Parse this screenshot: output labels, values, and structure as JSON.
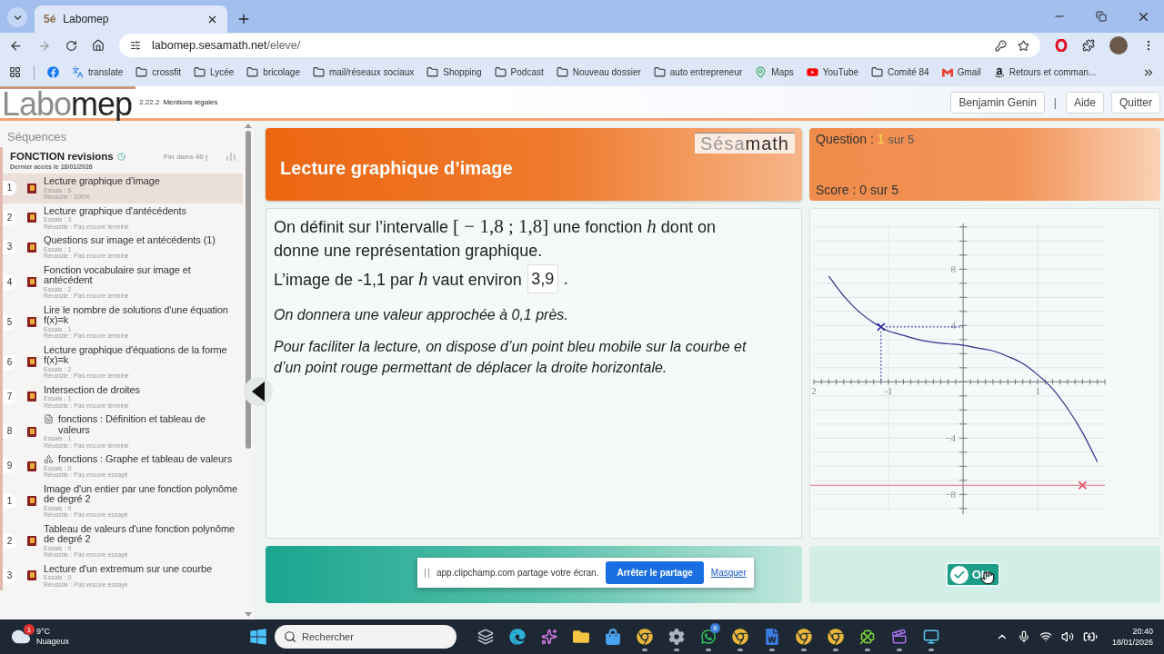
{
  "browser": {
    "tabs": [
      {
        "favicon": "5é",
        "title": "Labomep",
        "selected": true
      }
    ],
    "url": {
      "host": "labomep.sesamath.net",
      "path": "/eleve/"
    },
    "bookmarks": [
      {
        "kind": "facebook"
      },
      {
        "kind": "translate",
        "label": "translate"
      },
      {
        "kind": "folder",
        "label": "crossfit"
      },
      {
        "kind": "folder",
        "label": "Lycée"
      },
      {
        "kind": "folder",
        "label": "bricolage"
      },
      {
        "kind": "folder",
        "label": "mail/réseaux sociaux"
      },
      {
        "kind": "folder",
        "label": "Shopping"
      },
      {
        "kind": "folder",
        "label": "Podcast"
      },
      {
        "kind": "folder",
        "label": "Nouveau dossier"
      },
      {
        "kind": "folder",
        "label": "auto entrepreneur"
      },
      {
        "kind": "maps",
        "label": "Maps"
      },
      {
        "kind": "youtube",
        "label": "YouTube"
      },
      {
        "kind": "folder",
        "label": "Comité 84"
      },
      {
        "kind": "gmail",
        "label": "Gmail"
      },
      {
        "kind": "amazon",
        "label": "Retours et comman..."
      }
    ]
  },
  "app_header": {
    "logo": [
      "Labo",
      "mep"
    ],
    "version": "2.22.2",
    "legal_link": "Mentions légales",
    "user": "Benjamin Genin",
    "separator": "|",
    "help": "Aide",
    "quit": "Quitter"
  },
  "sidebar": {
    "heading": "Séquences",
    "sequence": {
      "title": "FONCTION revisions",
      "deadline": "Fin dans 40 j",
      "last_access": "Dernier accès le 18/01/2026"
    },
    "items": [
      {
        "number": "1",
        "kind": "plain",
        "title": "Lecture graphique d’image",
        "tries": "Essais : 5",
        "success": "Réussite : 100%",
        "selected": true
      },
      {
        "number": "2",
        "kind": "plain",
        "title": "Lecture graphique d'antécédents",
        "tries": "Essais : 3",
        "success": "Réussite : Pas encore terminé",
        "selected": false
      },
      {
        "number": "3",
        "kind": "plain",
        "title": "Questions sur image et antécédents (1)",
        "tries": "Essais : 1",
        "success": "Réussite : Pas encore terminé",
        "selected": false
      },
      {
        "number": "4",
        "kind": "plain",
        "title": "Fonction vocabulaire sur image et antécédent",
        "tries": "Essais : 2",
        "success": "Réussite : Pas encore terminé",
        "selected": false
      },
      {
        "number": "5",
        "kind": "plain",
        "title": "Lire le nombre de solutions d'une équation f(x)=k",
        "tries": "Essais : 1",
        "success": "Réussite : Pas encore terminé",
        "selected": false
      },
      {
        "number": "6",
        "kind": "plain",
        "title": "Lecture graphique d'équations de la forme f(x)=k",
        "tries": "Essais : 2",
        "success": "Réussite : Pas encore terminé",
        "selected": false
      },
      {
        "number": "7",
        "kind": "plain",
        "title": "Intersection de droites",
        "tries": "Essais : 1",
        "success": "Réussite : Pas encore terminé",
        "selected": false
      },
      {
        "number": "8",
        "kind": "sheet",
        "title": "fonctions : Définition et tableau de valeurs",
        "tries": "Essais : 1",
        "success": "Réussite : Pas encore terminé",
        "selected": false
      },
      {
        "number": "9",
        "kind": "tool",
        "title": "fonctions : Graphe et tableau de valeurs",
        "tries": "Essais : 0",
        "success": "Réussite : Pas encore essayé",
        "selected": false
      },
      {
        "number": "1",
        "kind": "plain",
        "title": "Image d'un entier par une fonction polynôme de degré 2",
        "tries": "Essais : 0",
        "success": "Réussite : Pas encore essayé",
        "selected": false
      },
      {
        "number": "2",
        "kind": "plain",
        "title": "Tableau de valeurs d'une fonction polynôme de degré 2",
        "tries": "Essais : 0",
        "success": "Réussite : Pas encore essayé",
        "selected": false
      },
      {
        "number": "3",
        "kind": "plain",
        "title": "Lecture d'un extremum sur une courbe",
        "tries": "Essais : 0",
        "success": "Réussite : Pas encore essayé",
        "selected": false
      }
    ]
  },
  "exercise": {
    "title": "Lecture graphique d’image",
    "brand": [
      "Sésa",
      "math"
    ],
    "question": {
      "label": "Question :",
      "current": "1",
      "total": "sur 5"
    },
    "score": "Score : 0 sur 5",
    "statement": [
      {
        "kind": "text",
        "text": "On définit sur l’intervalle "
      },
      {
        "kind": "math",
        "text": "[ − 1,8 ; 1,8]"
      },
      {
        "kind": "text",
        "text": " une fonction "
      },
      {
        "kind": "var",
        "text": "h"
      },
      {
        "kind": "text",
        "text": " dont on donne une représentation graphique."
      }
    ],
    "prompt": [
      {
        "kind": "text",
        "text": "L’image de -1,1 par "
      },
      {
        "kind": "var",
        "text": "h"
      },
      {
        "kind": "text",
        "text": " vaut environ"
      }
    ],
    "answer": "3,9",
    "answer_end": ".",
    "notes": [
      "On donnera une valeur approchée à 0,1 près.",
      "Pour faciliter la lecture, on dispose d’un point bleu mobile sur la courbe et d’un point rouge permettant de déplacer la droite horizontale."
    ],
    "graph": {
      "chart_data": {
        "type": "line",
        "x": [
          -1.8,
          -1.6,
          -1.4,
          -1.2,
          -1.1,
          -1.0,
          -0.8,
          -0.6,
          -0.4,
          -0.2,
          0,
          0.2,
          0.4,
          0.6,
          0.8,
          1.0,
          1.2,
          1.4,
          1.6,
          1.8
        ],
        "series": [
          {
            "color": "#2d2f8a",
            "values": [
              7.5,
              6.1,
              5.0,
              4.2,
              3.9,
              3.6,
              3.3,
              3.0,
              2.8,
              2.7,
              2.6,
              2.4,
              2.2,
              1.8,
              1.3,
              0.5,
              -0.5,
              -1.9,
              -3.6,
              -5.7
            ]
          },
          {
            "color": "#2a2f9c",
            "marker": "x",
            "values": [
              null,
              null,
              null,
              null,
              3.9,
              null,
              null,
              null,
              null,
              null,
              null,
              null,
              null,
              null,
              null,
              null,
              null,
              null,
              null,
              null
            ]
          },
          {
            "color": "#e0304a",
            "marker": "x",
            "values": [
              null,
              null,
              null,
              null,
              null,
              null,
              null,
              null,
              null,
              null,
              null,
              null,
              null,
              null,
              null,
              null,
              null,
              null,
              -7.35,
              null
            ]
          }
        ],
        "xlim": [
          -2.0,
          1.9
        ],
        "ylim": [
          -9.4,
          11.25
        ],
        "grid": true,
        "xticks": [
          {
            "value": -2,
            "label": "2"
          },
          {
            "value": -1,
            "label": "-1"
          },
          {
            "value": 1,
            "label": "1"
          }
        ],
        "yticks": [
          {
            "value": -8,
            "label": "−8"
          },
          {
            "value": -4,
            "label": "−4"
          },
          {
            "value": 4,
            "label": "4"
          },
          {
            "value": 8,
            "label": "8"
          }
        ],
        "ref_lines": [
          {
            "axis": "y",
            "value": -7.35,
            "color": "#e0707a"
          }
        ]
      }
    },
    "ok_button": "OK"
  },
  "share_bar": {
    "message": "app.clipchamp.com partage votre écran.",
    "stop": "Arrêter le partage",
    "hide": "Masquer"
  },
  "taskbar": {
    "weather": {
      "temp": "9°C",
      "condition": "Nuageux",
      "badge": "1"
    },
    "search_placeholder": "Rechercher",
    "apps": [
      {
        "kind": "files",
        "running": false
      },
      {
        "kind": "edge",
        "running": false
      },
      {
        "kind": "copilot",
        "running": false
      },
      {
        "kind": "folder",
        "running": false
      },
      {
        "kind": "store",
        "running": false
      },
      {
        "kind": "chrome",
        "running": true
      },
      {
        "kind": "settings",
        "running": true
      },
      {
        "kind": "whatsapp",
        "running": true,
        "badge": "6"
      },
      {
        "kind": "chrome",
        "running": true
      },
      {
        "kind": "word",
        "running": true
      },
      {
        "kind": "chrome",
        "running": true
      },
      {
        "kind": "chrome",
        "running": true
      },
      {
        "kind": "clover",
        "running": true
      },
      {
        "kind": "clapper",
        "running": true
      },
      {
        "kind": "screen",
        "running": true
      }
    ],
    "time": "20:40",
    "date": "18/01/2026"
  }
}
